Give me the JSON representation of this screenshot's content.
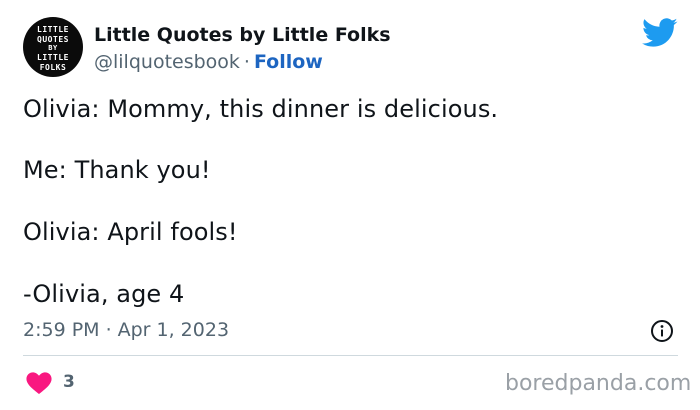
{
  "author": {
    "display_name": "Little Quotes by Little Folks",
    "handle": "@lilquotesbook",
    "separator": "·",
    "follow_label": "Follow",
    "avatar_logo_lines": [
      "LITTLE",
      "QUOTES",
      "BY",
      "LITTLE",
      "FOLKS"
    ]
  },
  "tweet": {
    "lines": [
      "Olivia: Mommy, this dinner is delicious.",
      "Me: Thank you!",
      "Olivia: April fools!",
      "-Olivia, age 4"
    ],
    "time": "2:59 PM",
    "date_separator": "·",
    "date": "Apr 1, 2023"
  },
  "engagement": {
    "like_count": "3"
  },
  "watermark": "boredpanda.com",
  "icons": {
    "brand": "twitter-bird-icon",
    "info": "info-icon",
    "like": "heart-icon"
  },
  "colors": {
    "twitter_blue": "#1d9bf0",
    "follow_link": "#1d65c1",
    "heart": "#f91880",
    "secondary_text": "#536471",
    "divider": "#cfd9de"
  }
}
